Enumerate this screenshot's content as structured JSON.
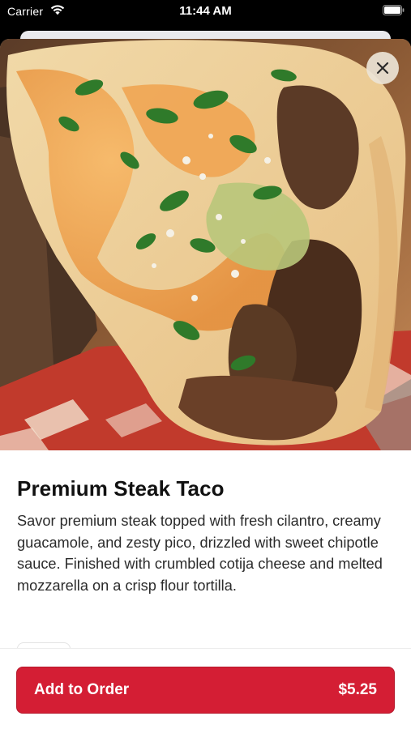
{
  "status_bar": {
    "carrier": "Carrier",
    "time": "11:44 AM"
  },
  "item": {
    "title": "Premium Steak Taco",
    "description": "Savor premium steak topped with fresh cilantro, creamy guacamole, and zesty pico, drizzled with sweet chipotle sauce. Finished with crumbled cotija cheese and melted mozzarella on a crisp flour tortilla.",
    "image_alt": "taco-photo"
  },
  "actions": {
    "add_label": "Add to Order",
    "price": "$5.25"
  },
  "colors": {
    "accent": "#d41e34",
    "close_bg": "#ece4d6"
  },
  "icons": {
    "close": "close-icon",
    "wifi": "wifi-icon",
    "battery": "battery-icon"
  }
}
